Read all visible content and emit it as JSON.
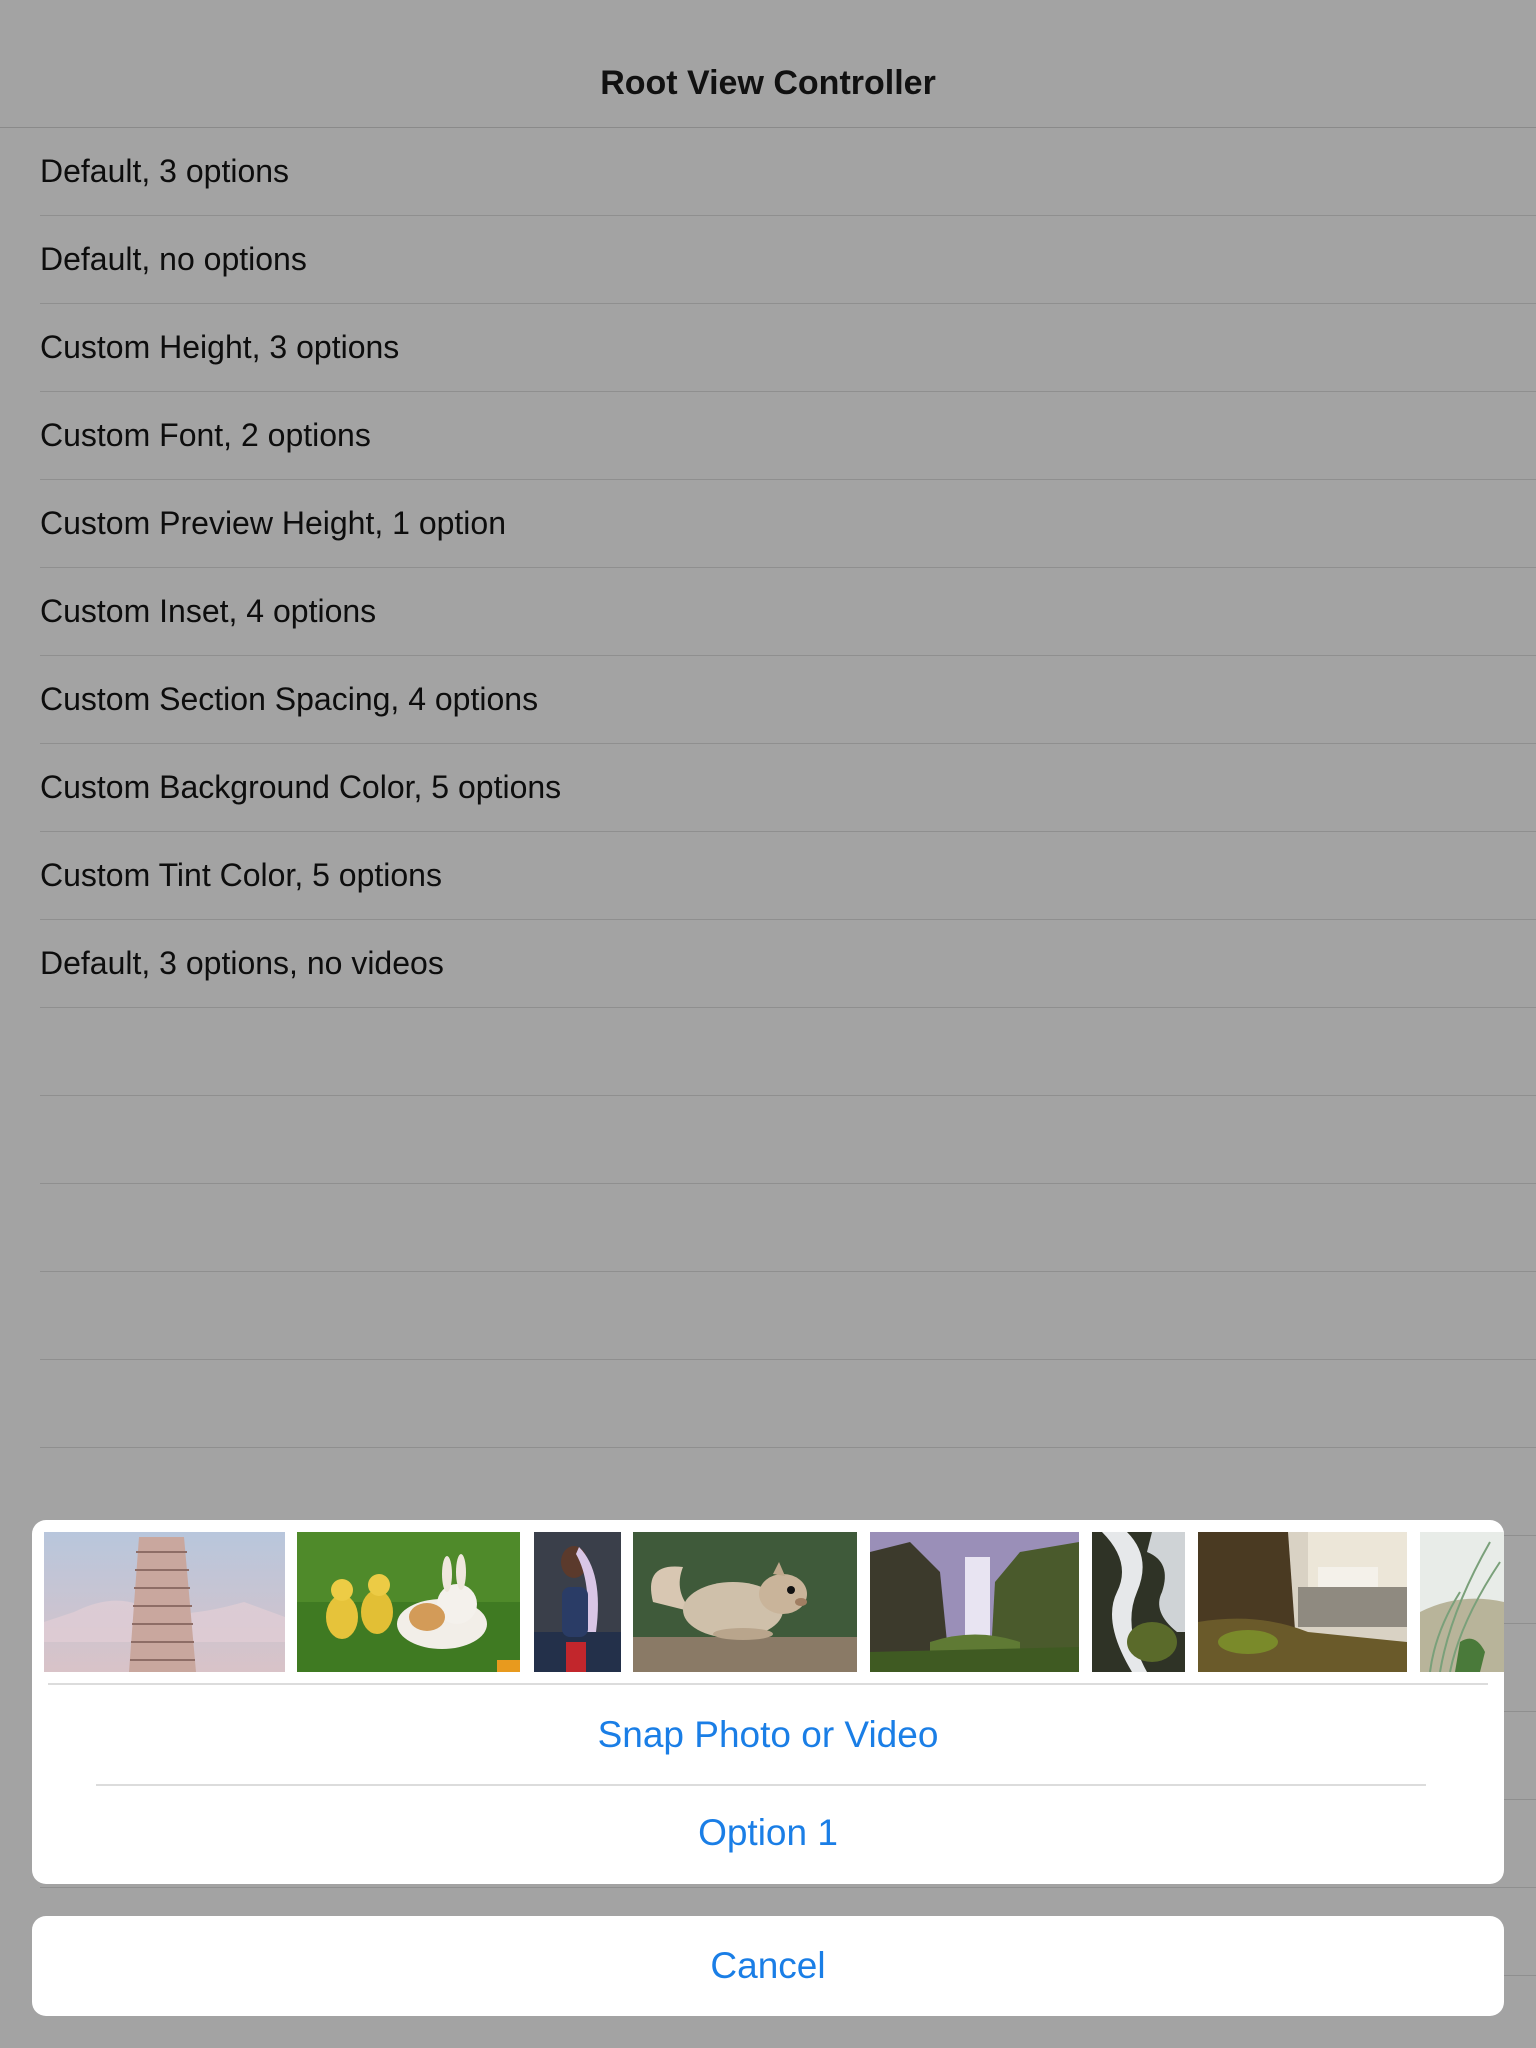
{
  "navbar": {
    "title": "Root View Controller"
  },
  "table": {
    "rows": [
      "Default, 3 options",
      "Default, no options",
      "Custom Height, 3 options",
      "Custom Font, 2 options",
      "Custom Preview Height, 1 option",
      "Custom Inset, 4 options",
      "Custom Section Spacing, 4 options",
      "Custom Background Color, 5 options",
      "Custom Tint Color, 5 options",
      "Default, 3 options, no videos"
    ]
  },
  "action_sheet": {
    "snap_label": "Snap Photo or Video",
    "option1_label": "Option 1",
    "cancel_label": "Cancel"
  },
  "colors": {
    "tint": "#1a7ee6",
    "dimmed_background": "#a3a3a3",
    "sheet_background": "#ffffff"
  }
}
